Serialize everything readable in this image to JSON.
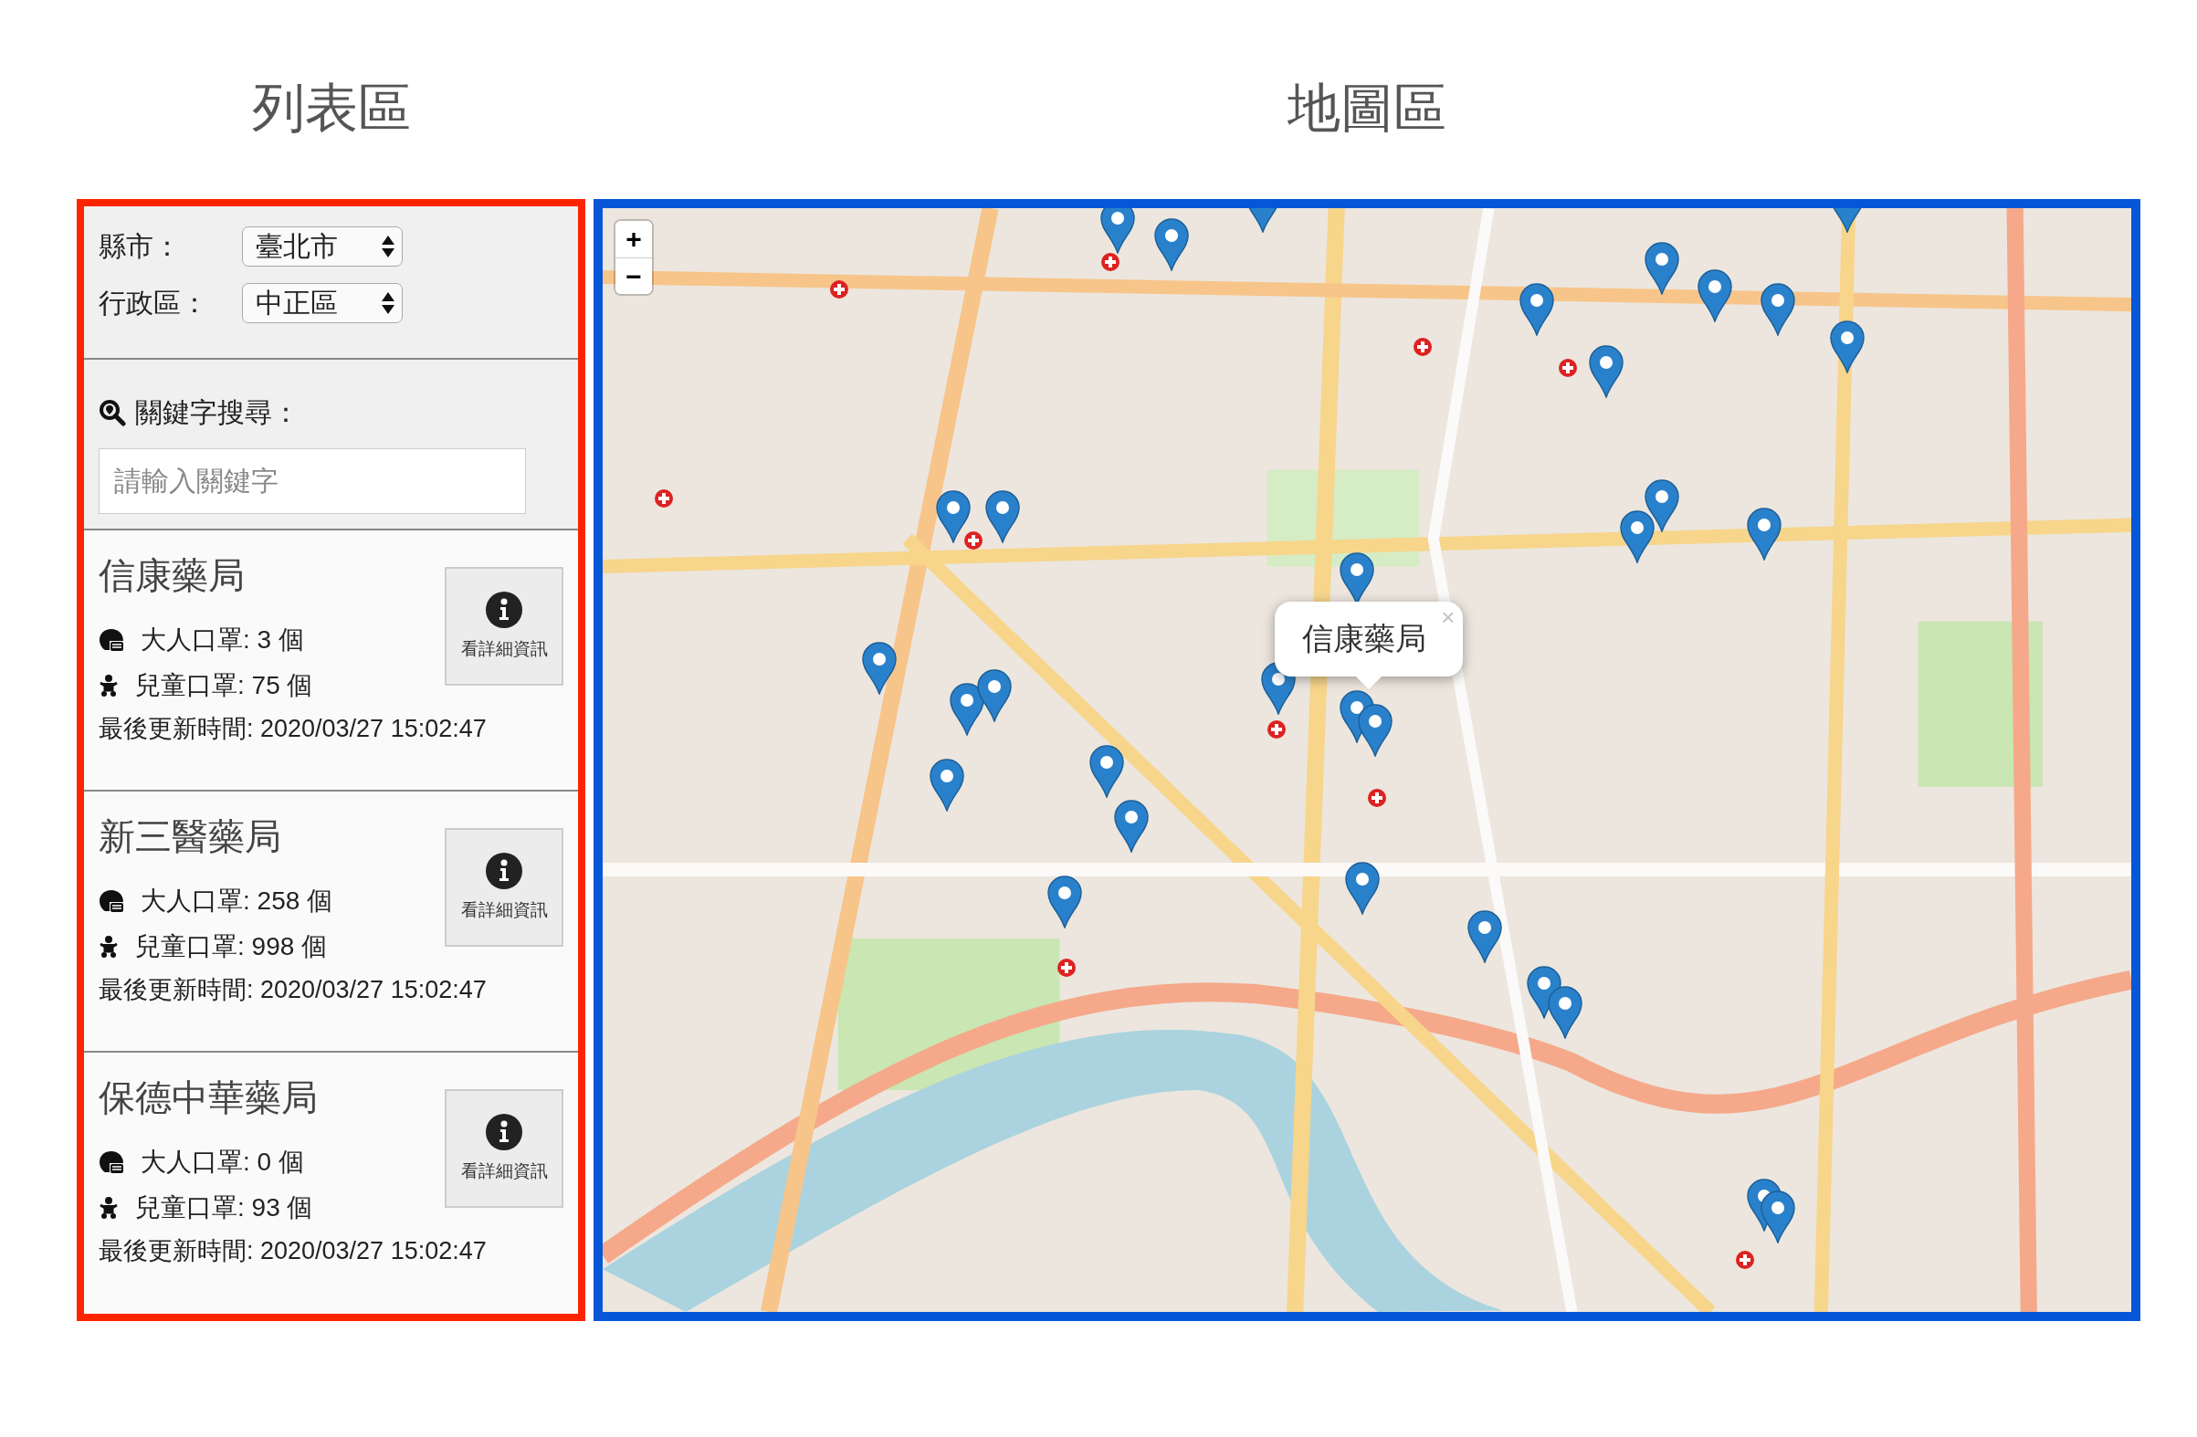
{
  "headings": {
    "list": "列表區",
    "map": "地圖區"
  },
  "filters": [
    {
      "label": "縣市：",
      "value": "臺北市"
    },
    {
      "label": "行政區：",
      "value": "中正區"
    }
  ],
  "search": {
    "label": "關鍵字搜尋：",
    "placeholder": "請輸入關鍵字"
  },
  "pharmacies": [
    {
      "name": "信康藥局",
      "adult": "大人口罩: 3 個",
      "child": "兒童口罩: 75 個",
      "updated": "最後更新時間: 2020/03/27 15:02:47",
      "button": "看詳細資訊"
    },
    {
      "name": "新三醫藥局",
      "adult": "大人口罩: 258 個",
      "child": "兒童口罩: 998 個",
      "updated": "最後更新時間: 2020/03/27 15:02:47",
      "button": "看詳細資訊"
    },
    {
      "name": "保德中華藥局",
      "adult": "大人口罩: 0 個",
      "child": "兒童口罩: 93 個",
      "updated": "最後更新時間: 2020/03/27 15:02:47",
      "button": "看詳細資訊"
    }
  ],
  "map": {
    "zoom_in": "+",
    "zoom_out": "−",
    "popup": {
      "title": "信康藥局",
      "close": "×"
    }
  }
}
